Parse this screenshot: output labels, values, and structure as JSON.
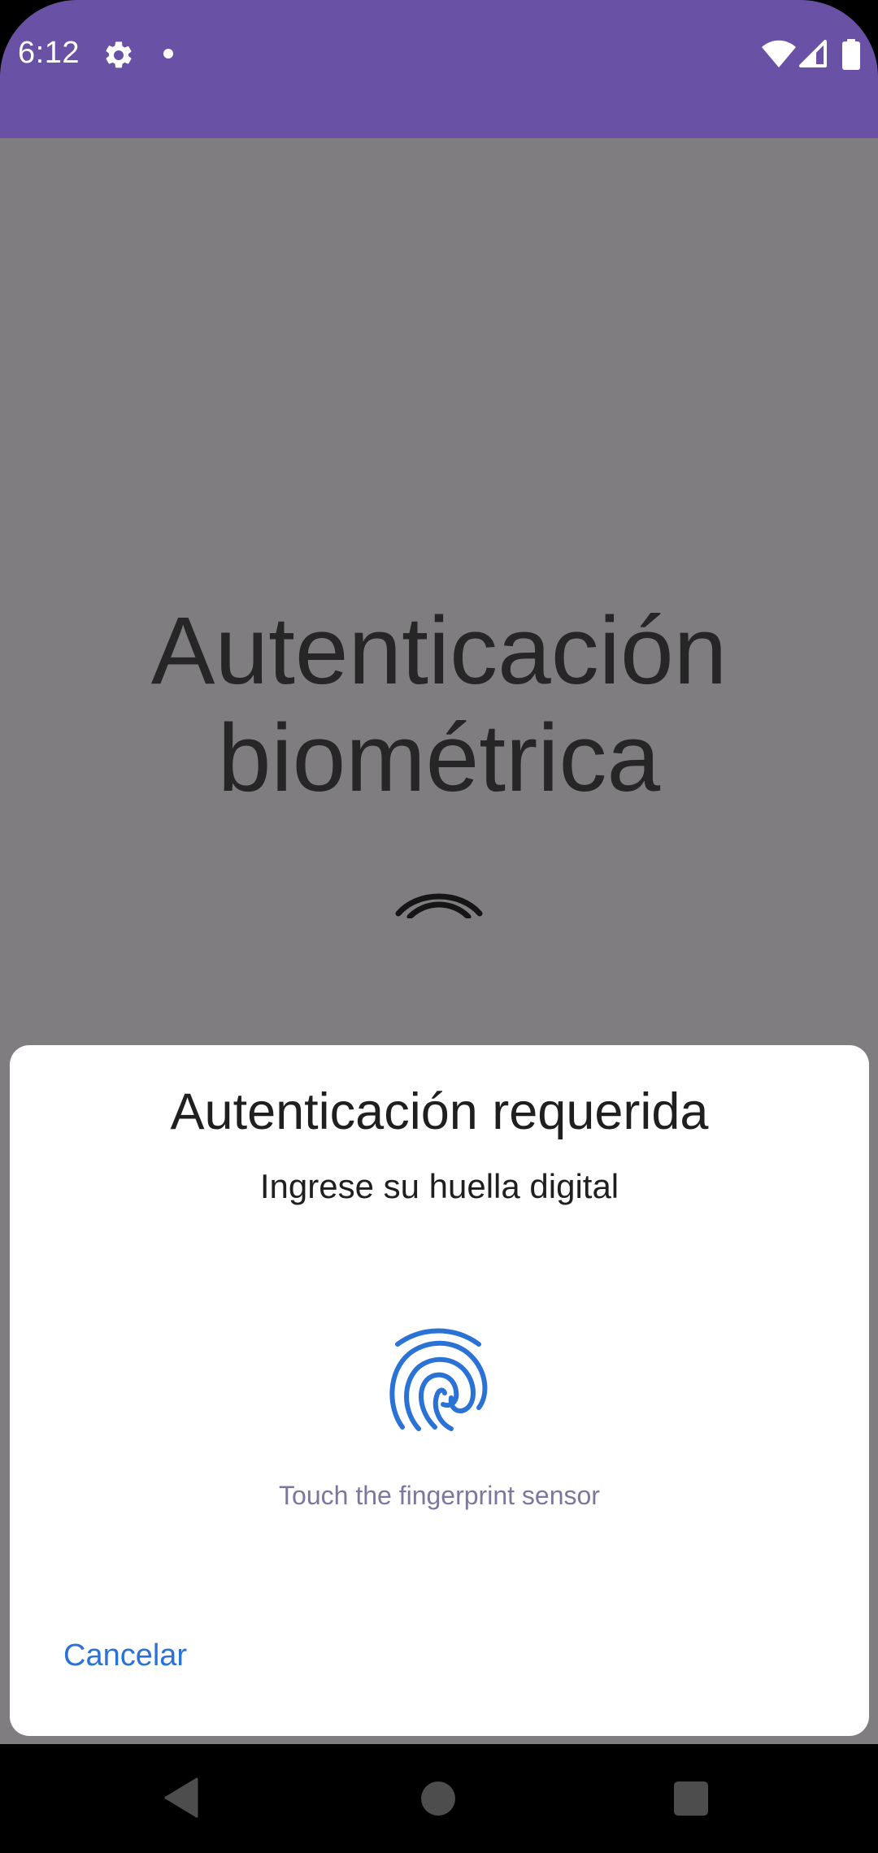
{
  "status_bar": {
    "time": "6:12",
    "background_color": "#6951a5",
    "icons": [
      "gear-icon",
      "notification-dot-icon",
      "wifi-icon",
      "cell-signal-icon",
      "battery-icon"
    ]
  },
  "app": {
    "title": "Autenticación\nbiométrica",
    "background_color": "#7f7d80"
  },
  "dialog": {
    "title": "Autenticación requerida",
    "subtitle": "Ingrese su huella digital",
    "icon": "fingerprint-icon",
    "hint": "Touch the fingerprint sensor",
    "cancel_label": "Cancelar",
    "accent_color": "#2a72d6"
  },
  "nav_bar": {
    "icons": [
      "back-icon",
      "home-icon",
      "recents-icon"
    ]
  }
}
